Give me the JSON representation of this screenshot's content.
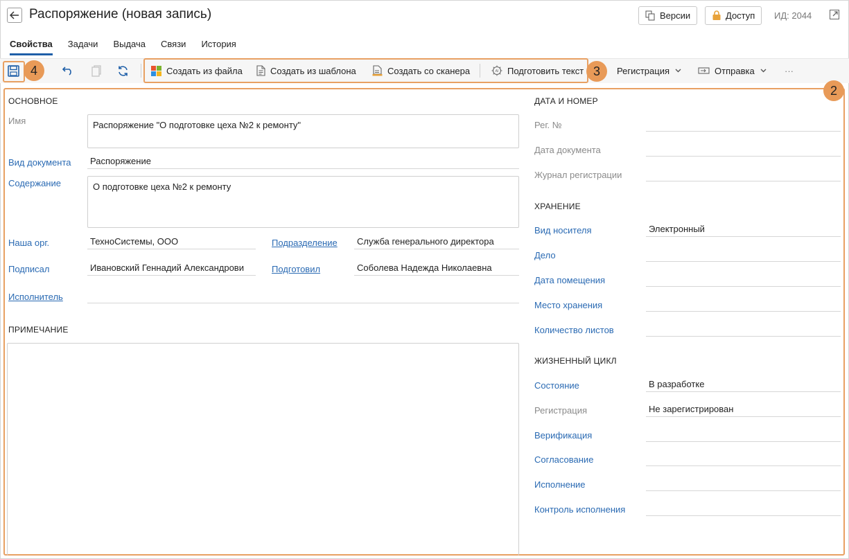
{
  "header": {
    "title": "Распоряжение (новая запись)",
    "versions_label": "Версии",
    "access_label": "Доступ",
    "id_label": "ИД: 2044"
  },
  "tabs": [
    {
      "label": "Свойства",
      "active": true
    },
    {
      "label": "Задачи"
    },
    {
      "label": "Выдача"
    },
    {
      "label": "Связи"
    },
    {
      "label": "История"
    }
  ],
  "toolbar": {
    "create_from_file": "Создать из файла",
    "create_from_template": "Создать из шаблона",
    "create_from_scanner": "Создать со сканера",
    "prepare_text": "Подготовить текст",
    "registration": "Регистрация",
    "sending": "Отправка",
    "more": "···"
  },
  "badges": {
    "b2": "2",
    "b3": "3",
    "b4": "4"
  },
  "colors": {
    "accent": "#1f5fa8",
    "link": "#2a6ab3",
    "highlight": "#e8a062"
  },
  "main": {
    "section_title": "ОСНОВНОЕ",
    "name_label": "Имя",
    "name_value": "Распоряжение \"О подготовке цеха №2 к ремонту\"",
    "doc_type_label": "Вид документа",
    "doc_type_value": "Распоряжение",
    "content_label": "Содержание",
    "content_value": "О подготовке цеха №2 к ремонту",
    "our_org_label": "Наша орг.",
    "our_org_value": "ТехноСистемы, ООО",
    "department_label": "Подразделение",
    "department_value": "Служба генерального директора",
    "signed_label": "Подписал",
    "signed_value": "Ивановский Геннадий Александрови",
    "prepared_label": "Подготовил",
    "prepared_value": "Соболева Надежда Николаевна",
    "executor_label": "Исполнитель",
    "executor_value": ""
  },
  "note": {
    "section_title": "ПРИМЕЧАНИЕ",
    "value": ""
  },
  "date_number": {
    "section_title": "ДАТА И НОМЕР",
    "reg_no_label": "Рег. №",
    "doc_date_label": "Дата документа",
    "journal_label": "Журнал регистрации"
  },
  "storage": {
    "section_title": "ХРАНЕНИЕ",
    "media_label": "Вид носителя",
    "media_value": "Электронный",
    "case_label": "Дело",
    "placement_date_label": "Дата помещения",
    "location_label": "Место хранения",
    "sheets_label": "Количество листов"
  },
  "lifecycle": {
    "section_title": "ЖИЗНЕННЫЙ ЦИКЛ",
    "state_label": "Состояние",
    "state_value": "В разработке",
    "registration_label": "Регистрация",
    "registration_value": "Не зарегистрирован",
    "verification_label": "Верификация",
    "approval_label": "Согласование",
    "execution_label": "Исполнение",
    "control_label": "Контроль исполнения"
  }
}
